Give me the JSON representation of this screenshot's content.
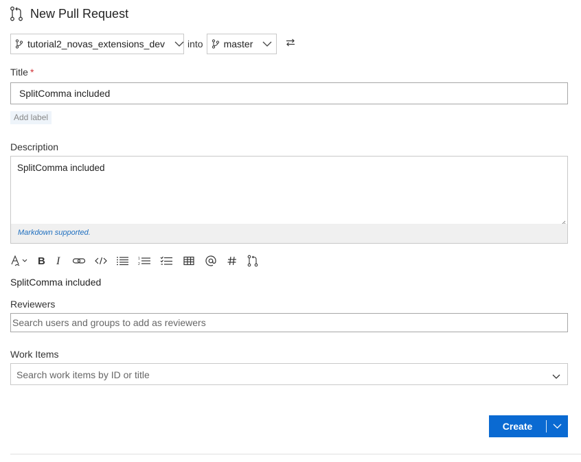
{
  "header": {
    "title": "New Pull Request",
    "icon": "pull-request-icon"
  },
  "branches": {
    "source": "tutorial2_novas_extensions_dev",
    "into_label": "into",
    "target": "master",
    "branch_icon": "branch-icon",
    "swap_icon": "swap-icon"
  },
  "title_field": {
    "label": "Title",
    "required_marker": "*",
    "value": "SplitComma included"
  },
  "labels": {
    "add_label": "Add label"
  },
  "description": {
    "label": "Description",
    "value": "SplitComma included",
    "markdown_note": "Markdown supported."
  },
  "toolbar": {
    "items": [
      "format-icon",
      "bold-icon",
      "italic-icon",
      "link-icon",
      "code-icon",
      "bulleted-list-icon",
      "numbered-list-icon",
      "checklist-icon",
      "table-icon",
      "mention-icon",
      "work-item-hash-icon",
      "pull-request-link-icon"
    ]
  },
  "preview": {
    "text": "SplitComma included"
  },
  "reviewers": {
    "label": "Reviewers",
    "placeholder": "Search users and groups to add as reviewers"
  },
  "work_items": {
    "label": "Work Items",
    "placeholder": "Search work items by ID or title"
  },
  "actions": {
    "create_label": "Create"
  },
  "colors": {
    "accent": "#0a6ad2",
    "required": "#d13438",
    "link": "#1f6fbf"
  }
}
